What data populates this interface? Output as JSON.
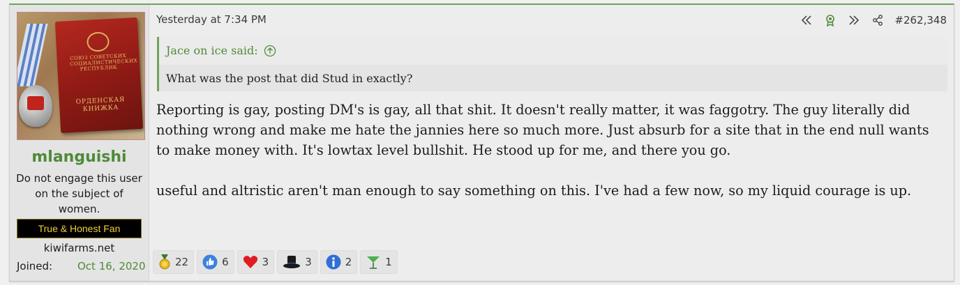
{
  "user": {
    "avatar_lettering": {
      "top": "СОЮЗ СОВЕТСКИХ СОЦИАЛИСТИЧЕСКИХ РЕСПУБЛИК",
      "bottom": "ОРДЕНСКАЯ КНИЖКА"
    },
    "username": "mlanguishi",
    "title": "Do not engage this user on the subject of women.",
    "banner": "True & Honest Fan",
    "site": "kiwifarms.net",
    "joined_label": "Joined:",
    "joined_date": "Oct 16, 2020"
  },
  "post": {
    "timestamp": "Yesterday at 7:34 PM",
    "post_number": "#262,348",
    "quote": {
      "author": "Jace on ice said:",
      "text": "What was the post that did Stud in exactly?"
    },
    "paragraphs": [
      "Reporting is gay, posting DM's is gay, all that shit. It doesn't really matter, it was faggotry. The guy literally did nothing wrong and make me hate the jannies here so much more. Just absurb for a site that in the end null wants to make money with. It's lowtax level bullshit. He stood up for me, and there you go.",
      "useful and altristic aren't man enough to say something on this. I've had a few now, so my liquid courage is up."
    ]
  },
  "reactions": [
    {
      "icon": "gold-medal-icon",
      "count": "22"
    },
    {
      "icon": "thumbs-up-icon",
      "count": "6"
    },
    {
      "icon": "heart-icon",
      "count": "3"
    },
    {
      "icon": "top-hat-icon",
      "count": "3"
    },
    {
      "icon": "info-icon",
      "count": "2"
    },
    {
      "icon": "cocktail-icon",
      "count": "1"
    }
  ],
  "colors": {
    "accent_green": "#4f8a3a",
    "banner_text": "#f1cf35"
  }
}
